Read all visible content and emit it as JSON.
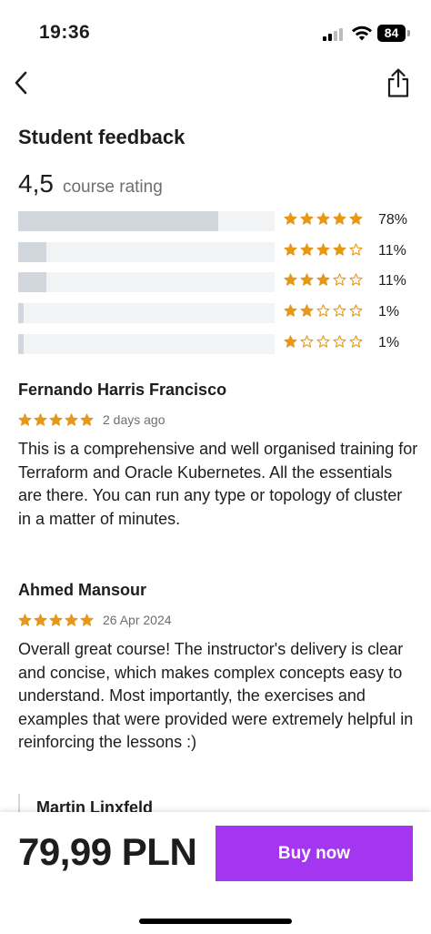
{
  "status_bar": {
    "time": "19:36",
    "battery": "84"
  },
  "nav": {
    "back_icon": "chevron-left-icon",
    "share_icon": "share-icon"
  },
  "section_title": "Student feedback",
  "rating": {
    "value": "4,5",
    "label": "course rating"
  },
  "distribution": [
    {
      "stars": 5,
      "percent_label": "78%",
      "fraction": 0.78
    },
    {
      "stars": 4,
      "percent_label": "11%",
      "fraction": 0.11
    },
    {
      "stars": 3,
      "percent_label": "11%",
      "fraction": 0.11
    },
    {
      "stars": 2,
      "percent_label": "1%",
      "fraction": 0.01
    },
    {
      "stars": 1,
      "percent_label": "1%",
      "fraction": 0.01
    }
  ],
  "reviews": [
    {
      "name": "Fernando Harris Francisco",
      "stars": 5,
      "date": "2 days ago",
      "text": "This is a comprehensive and well organised training for Terraform and Oracle Kubernetes. All the essentials are there. You can run any type or topology of cluster in a matter of minutes."
    },
    {
      "name": "Ahmed Mansour",
      "stars": 5,
      "date": "26 Apr 2024",
      "text": "Overall great course! The instructor's delivery is clear and concise, which makes complex concepts easy to understand. Most importantly, the exercises and examples that were provided were extremely helpful in reinforcing the lessons :)"
    },
    {
      "name": "Martin Linxfeld"
    }
  ],
  "purchase": {
    "price": "79,99 PLN",
    "buy_label": "Buy now"
  },
  "colors": {
    "accent": "#a435f0",
    "star": "#e59819",
    "bar_fill": "#d1d7dc",
    "bar_track": "#f2f3f5"
  }
}
